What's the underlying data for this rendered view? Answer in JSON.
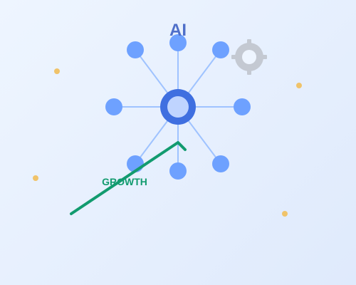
{
  "labels": {
    "title": "AI",
    "growth": "GROWTH"
  },
  "icons": {
    "gear": "gear-icon"
  },
  "colors": {
    "background_start": "#eef5ff",
    "background_end": "#dfeafc",
    "hub_ring": "#3f6fe0",
    "hub_center": "#bfd4ff",
    "node": "#6ea1ff",
    "connector": "#9fc3ff",
    "gear": "#c4c9d2",
    "growth": "#129b6f",
    "particle": "#f0c36a",
    "title": "#4f6fc9"
  }
}
